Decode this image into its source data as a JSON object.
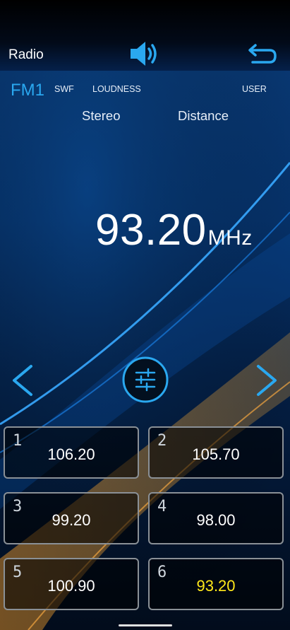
{
  "app": {
    "title": "Radio"
  },
  "status": {
    "band": "FM1",
    "flags": {
      "swf": "SWF",
      "loudness": "LOUDNESS",
      "user": "USER"
    },
    "modes": {
      "stereo": "Stereo",
      "distance": "Distance"
    }
  },
  "tuner": {
    "frequency": "93.20",
    "unit": "MHz"
  },
  "icons": {
    "speaker": "speaker-volume-icon",
    "back": "back-return-icon",
    "prev": "chevron-left-icon",
    "next": "chevron-right-icon",
    "equalizer": "equalizer-sliders-icon"
  },
  "presets": [
    {
      "number": "1",
      "frequency": "106.20"
    },
    {
      "number": "2",
      "frequency": "105.70"
    },
    {
      "number": "3",
      "frequency": "99.20"
    },
    {
      "number": "4",
      "frequency": "98.00"
    },
    {
      "number": "5",
      "frequency": "100.90"
    },
    {
      "number": "6",
      "frequency": "93.20"
    }
  ],
  "colors": {
    "accent_blue": "#2aa8f0",
    "active_preset": "#ffe81a",
    "background": "#031a3c",
    "glow_orange": "#e8962a"
  }
}
